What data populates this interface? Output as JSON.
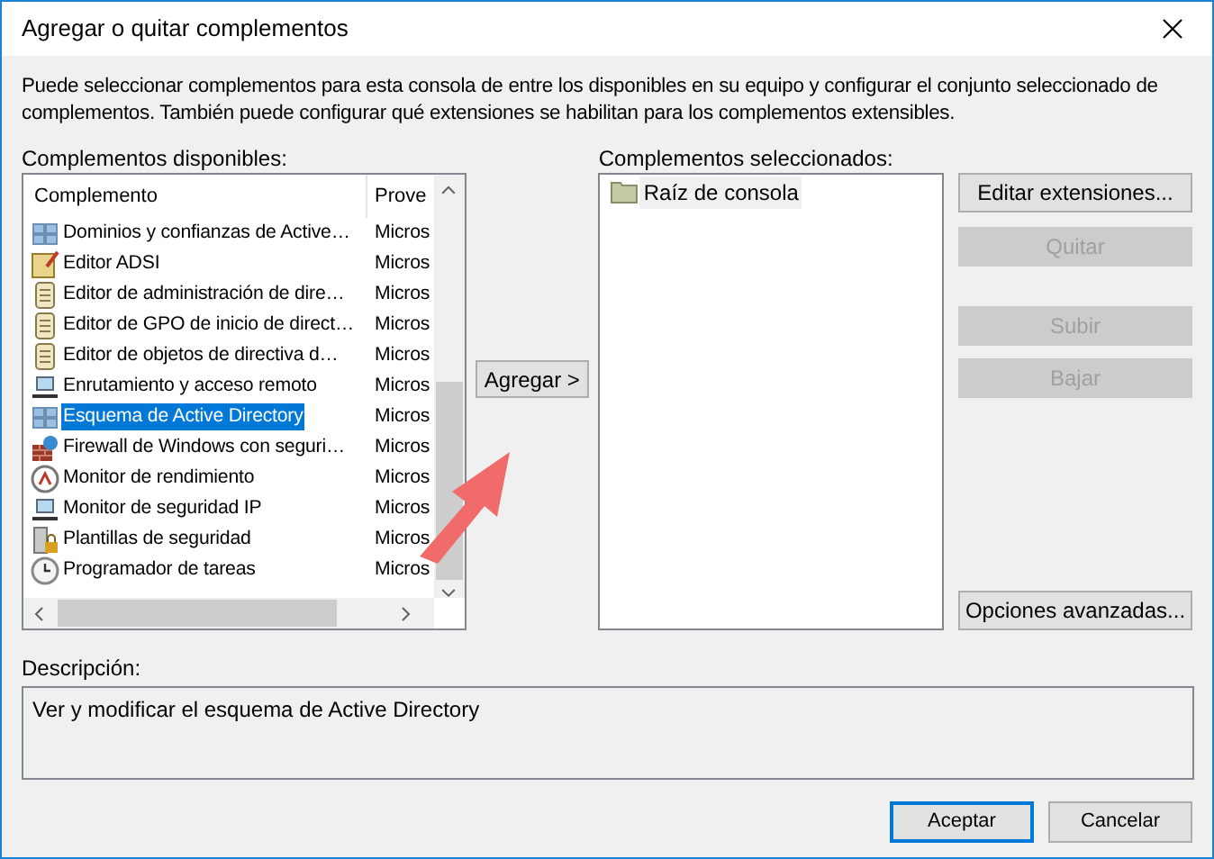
{
  "window": {
    "title": "Agregar o quitar complementos"
  },
  "intro": "Puede seleccionar complementos para esta consola de entre los disponibles en su equipo y configurar el conjunto seleccionado de complementos. También puede configurar qué extensiones se habilitan para los complementos extensibles.",
  "available": {
    "label": "Complementos disponibles:",
    "columns": [
      "Complemento",
      "Prove"
    ],
    "rows": [
      {
        "name": "Dominios y confianzas de Active…",
        "provider": "Micros",
        "selected": false
      },
      {
        "name": "Editor ADSI",
        "provider": "Micros",
        "selected": false
      },
      {
        "name": "Editor de administración de dire…",
        "provider": "Micros",
        "selected": false
      },
      {
        "name": "Editor de GPO de inicio de direct…",
        "provider": "Micros",
        "selected": false
      },
      {
        "name": "Editor de objetos de directiva d…",
        "provider": "Micros",
        "selected": false
      },
      {
        "name": "Enrutamiento y acceso remoto",
        "provider": "Micros",
        "selected": false
      },
      {
        "name": "Esquema de Active Directory",
        "provider": "Micros",
        "selected": true
      },
      {
        "name": "Firewall de Windows con seguri…",
        "provider": "Micros",
        "selected": false
      },
      {
        "name": "Monitor de rendimiento",
        "provider": "Micros",
        "selected": false
      },
      {
        "name": "Monitor de seguridad IP",
        "provider": "Micros",
        "selected": false
      },
      {
        "name": "Plantillas de seguridad",
        "provider": "Micros",
        "selected": false
      },
      {
        "name": "Programador de tareas",
        "provider": "Micros",
        "selected": false
      }
    ]
  },
  "add_button": "Agregar >",
  "selected_list": {
    "label": "Complementos seleccionados:",
    "items": [
      {
        "name": "Raíz de consola"
      }
    ]
  },
  "side_buttons": [
    {
      "label": "Editar extensiones...",
      "disabled": false
    },
    {
      "label": "Quitar",
      "disabled": true
    },
    {
      "label": "Subir",
      "disabled": true
    },
    {
      "label": "Bajar",
      "disabled": true
    }
  ],
  "advanced_button": "Opciones avanzadas...",
  "description": {
    "label": "Descripción:",
    "text": "Ver y modificar el esquema de Active Directory"
  },
  "footer_buttons": [
    {
      "label": "Aceptar",
      "default": true
    },
    {
      "label": "Cancelar",
      "default": false
    }
  ]
}
